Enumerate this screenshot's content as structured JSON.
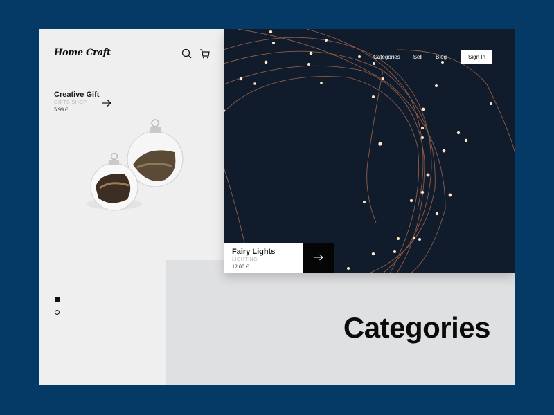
{
  "brand": {
    "logo": "Home Craft"
  },
  "header_icons": {
    "search": "search-icon",
    "cart": "cart-icon"
  },
  "nav": {
    "links": [
      "Categories",
      "Sell",
      "Blog"
    ],
    "sign_in_label": "Sign In"
  },
  "featured_left": {
    "name": "Creative Gift",
    "category": "GIFTS SHOP",
    "price": "5.99 €",
    "image": "glass-ornaments"
  },
  "featured_hero": {
    "name": "Fairy Lights",
    "category": "LIGHTING",
    "price": "12.00 €",
    "image": "fairy-lights"
  },
  "pagination": {
    "total": 2,
    "active": 1
  },
  "section_title": "Categories",
  "colors": {
    "page_bg": "#053a66",
    "panel_bg": "#efefef",
    "block_bg": "#dfe0e2",
    "hero_bg": "#0f1a2a",
    "accent_dark": "#050505"
  }
}
